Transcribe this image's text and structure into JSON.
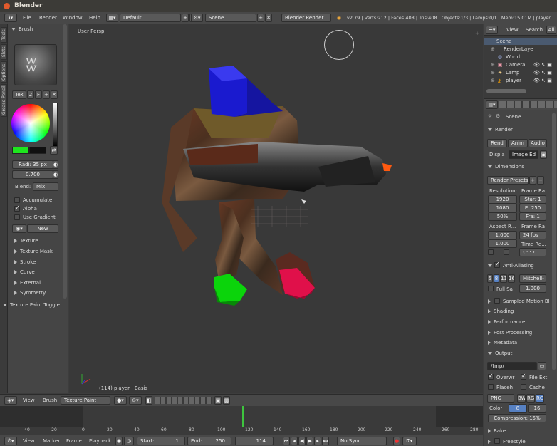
{
  "window": {
    "title": "Blender"
  },
  "topbar": {
    "menus": [
      "File",
      "Render",
      "Window",
      "Help"
    ],
    "layout": "Default",
    "scene": "Scene",
    "engine": "Blender Render",
    "stats": "v2.79 | Verts:212 | Faces:408 | Tris:408 | Objects:1/3 | Lamps:0/1 | Mem:15.01M | player"
  },
  "tool_tabs": [
    "Tools",
    "Slots",
    "Options",
    "Grease Pencil"
  ],
  "brush_panel": {
    "title": "Brush",
    "tex_label": "Tex",
    "users": "2",
    "fake_user": "F",
    "radius": "Radi: 35 px",
    "strength": "0.700",
    "blend_label": "Blend:",
    "blend_value": "Mix",
    "accumulate": "Accumulate",
    "alpha": "Alpha",
    "use_gradient": "Use Gradient",
    "new_button": "New",
    "color": "#1ee51e",
    "secondary_color": "#101010"
  },
  "brush_sections": [
    "Texture",
    "Texture Mask",
    "Stroke",
    "Curve",
    "External",
    "Symmetry"
  ],
  "texture_paint_toggle": "Texture Paint Toggle",
  "viewport": {
    "label": "User Persp",
    "status": "(114) player : Basis"
  },
  "viewport_header": {
    "view": "View",
    "brush": "Brush",
    "mode": "Texture Paint"
  },
  "outliner": {
    "header": [
      "View",
      "Search",
      "All"
    ],
    "items": [
      "Scene",
      "RenderLaye",
      "World",
      "Camera",
      "Lamp",
      "player"
    ]
  },
  "properties": {
    "scene": "Scene",
    "render": {
      "title": "Render",
      "render_btn": "Rend",
      "anim_btn": "Anim",
      "audio_btn": "Audio",
      "display_label": "Displa",
      "display_value": "Image Ed"
    },
    "dimensions": {
      "title": "Dimensions",
      "presets": "Render Presets",
      "resolution_label": "Resolution:",
      "frame_range_label": "Frame Ra",
      "res_x": "1920",
      "res_y": "1080",
      "res_pct": "50%",
      "start": "Star: 1",
      "end": "E: 250",
      "step": "Fra: 1",
      "aspect_label": "Aspect R...",
      "frame_rate_label": "Frame Ra",
      "aspect_x": "1.000",
      "aspect_y": "1.000",
      "fps": "24 fps",
      "time_remap": "Time Re..."
    },
    "anti_aliasing": {
      "title": "Anti-Aliasing",
      "samples": [
        "5",
        "8",
        "11",
        "16"
      ],
      "filter": "Mitchell-",
      "full_sample": "Full Sa",
      "size": "1.000"
    },
    "sections": [
      "Sampled Motion Bl",
      "Shading",
      "Performance",
      "Post Processing",
      "Metadata"
    ],
    "output": {
      "title": "Output",
      "path": "/tmp/",
      "overwrite": "Overwr",
      "file_ext": "File Ext",
      "placeholders": "Placeh",
      "cache": "Cache",
      "format": "PNG",
      "bw": "BW",
      "rgb": "RG",
      "rgba": "RG",
      "color_label": "Color",
      "depth_8": "8",
      "depth_16": "16",
      "compression": "Compression:",
      "compression_value": "15%"
    },
    "bottom_sections": [
      "Bake",
      "Freestyle"
    ]
  },
  "timeline": {
    "view": "View",
    "marker": "Marker",
    "frame": "Frame",
    "playback": "Playback",
    "start": "Start:",
    "start_value": "1",
    "end": "End:",
    "end_value": "250",
    "current": "114",
    "sync": "No Sync",
    "ticks": [
      "-40",
      "-20",
      "0",
      "20",
      "40",
      "60",
      "80",
      "100",
      "120",
      "140",
      "160",
      "180",
      "200",
      "220",
      "240",
      "260",
      "280"
    ]
  }
}
